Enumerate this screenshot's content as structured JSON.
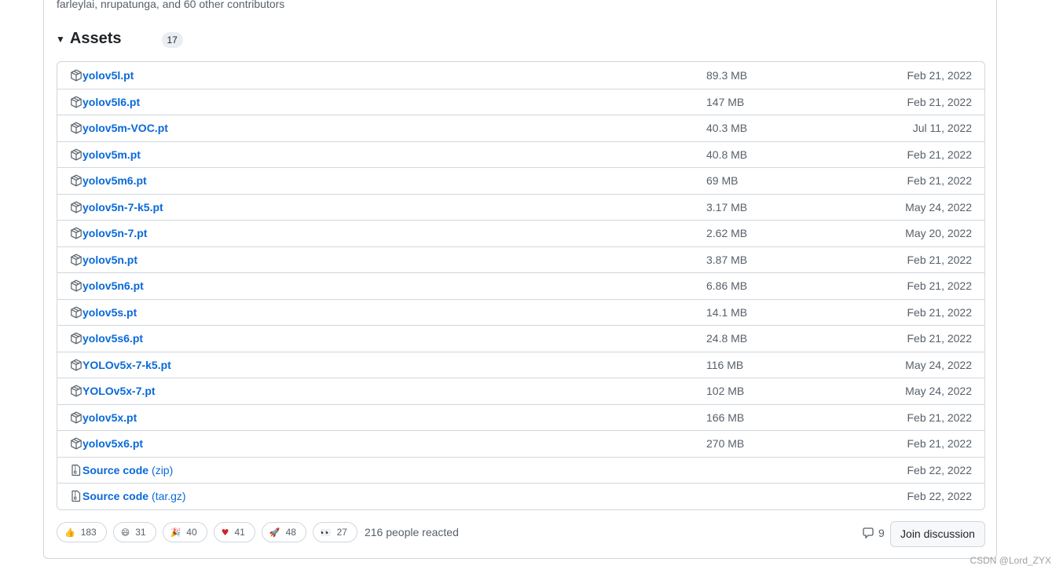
{
  "release": {
    "contributors_text": "farleylai, nrupatunga, and 60 other contributors"
  },
  "assets": {
    "title": "Assets",
    "count": "17",
    "items": [
      {
        "name": "yolov5l.pt",
        "suffix": "",
        "size": "89.3 MB",
        "date": "Feb 21, 2022",
        "icon": "package-icon"
      },
      {
        "name": "yolov5l6.pt",
        "suffix": "",
        "size": "147 MB",
        "date": "Feb 21, 2022",
        "icon": "package-icon"
      },
      {
        "name": "yolov5m-VOC.pt",
        "suffix": "",
        "size": "40.3 MB",
        "date": "Jul 11, 2022",
        "icon": "package-icon"
      },
      {
        "name": "yolov5m.pt",
        "suffix": "",
        "size": "40.8 MB",
        "date": "Feb 21, 2022",
        "icon": "package-icon"
      },
      {
        "name": "yolov5m6.pt",
        "suffix": "",
        "size": "69 MB",
        "date": "Feb 21, 2022",
        "icon": "package-icon"
      },
      {
        "name": "yolov5n-7-k5.pt",
        "suffix": "",
        "size": "3.17 MB",
        "date": "May 24, 2022",
        "icon": "package-icon"
      },
      {
        "name": "yolov5n-7.pt",
        "suffix": "",
        "size": "2.62 MB",
        "date": "May 20, 2022",
        "icon": "package-icon"
      },
      {
        "name": "yolov5n.pt",
        "suffix": "",
        "size": "3.87 MB",
        "date": "Feb 21, 2022",
        "icon": "package-icon"
      },
      {
        "name": "yolov5n6.pt",
        "suffix": "",
        "size": "6.86 MB",
        "date": "Feb 21, 2022",
        "icon": "package-icon"
      },
      {
        "name": "yolov5s.pt",
        "suffix": "",
        "size": "14.1 MB",
        "date": "Feb 21, 2022",
        "icon": "package-icon"
      },
      {
        "name": "yolov5s6.pt",
        "suffix": "",
        "size": "24.8 MB",
        "date": "Feb 21, 2022",
        "icon": "package-icon"
      },
      {
        "name": "YOLOv5x-7-k5.pt",
        "suffix": "",
        "size": "116 MB",
        "date": "May 24, 2022",
        "icon": "package-icon"
      },
      {
        "name": "YOLOv5x-7.pt",
        "suffix": "",
        "size": "102 MB",
        "date": "May 24, 2022",
        "icon": "package-icon"
      },
      {
        "name": "yolov5x.pt",
        "suffix": "",
        "size": "166 MB",
        "date": "Feb 21, 2022",
        "icon": "package-icon"
      },
      {
        "name": "yolov5x6.pt",
        "suffix": "",
        "size": "270 MB",
        "date": "Feb 21, 2022",
        "icon": "package-icon"
      },
      {
        "name": "Source code",
        "suffix": "(zip)",
        "size": "",
        "date": "Feb 22, 2022",
        "icon": "file-zip-icon"
      },
      {
        "name": "Source code",
        "suffix": "(tar.gz)",
        "size": "",
        "date": "Feb 22, 2022",
        "icon": "file-zip-icon"
      }
    ]
  },
  "reactions": {
    "items": [
      {
        "emoji": "👍",
        "icon": "thumbs-up-icon",
        "count": "183"
      },
      {
        "emoji": "😄",
        "icon": "laugh-icon",
        "count": "31"
      },
      {
        "emoji": "🎉",
        "icon": "hooray-icon",
        "count": "40"
      },
      {
        "emoji": "♥",
        "icon": "heart-icon",
        "count": "41"
      },
      {
        "emoji": "🚀",
        "icon": "rocket-icon",
        "count": "48"
      },
      {
        "emoji": "👀",
        "icon": "eyes-icon",
        "count": "27"
      }
    ],
    "summary": "216 people reacted"
  },
  "discussion": {
    "comment_count": "9",
    "join_label": "Join discussion"
  },
  "watermark": "CSDN @Lord_ZYX",
  "colors": {
    "link": "#0969da",
    "muted": "#57606a",
    "border": "#d0d7de",
    "heart": "#cf222e"
  }
}
